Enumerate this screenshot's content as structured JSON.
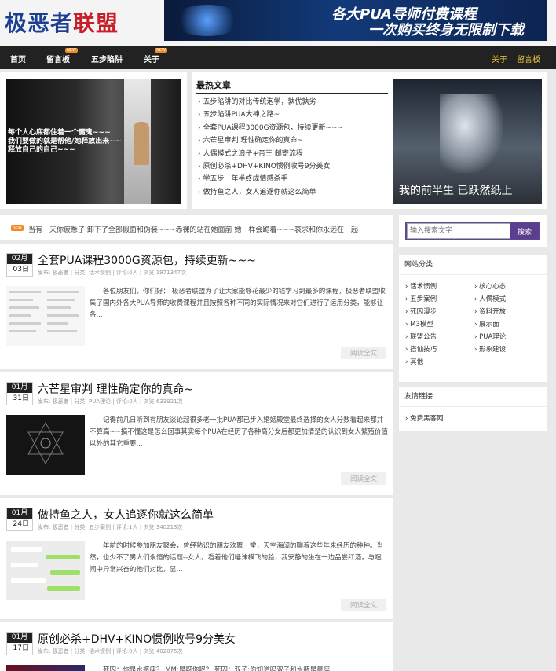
{
  "header": {
    "logo_part1": "极恶者",
    "logo_part2": "联盟",
    "banner_line1": "各大PUA导师付费课程",
    "banner_line2": "一次购买终身无限制下载"
  },
  "nav": {
    "items": [
      {
        "label": "首页"
      },
      {
        "label": "留言板",
        "badge": "NEW"
      },
      {
        "label": "五步陷阱"
      },
      {
        "label": "关于",
        "badge": "NEW"
      }
    ],
    "right": [
      "关于",
      "留言板"
    ]
  },
  "featured_left": {
    "caption": "每个人心底都住着一个魔鬼~~~\n我们要做的就是帮他/她释放出来~~\n释放自己的自己~~~"
  },
  "hot": {
    "title": "最热文章",
    "items": [
      "五步陷阱的对比传统泡学，孰优孰劣",
      "五步陷阱PUA大神之路~",
      "全套PUA课程3000G资源包，持续更新~~~",
      "六芒星审判 理性确定你的真命~",
      "人偶模式之浪子+帝王 邮寄流程",
      "原创必杀+DHV+KINO惯例收号9分美女",
      "学五步一年半终成情感杀手",
      "做持鱼之人，女人追逐你就这么简单"
    ]
  },
  "featured_right": {
    "caption": "我的前半生  已跃然纸上"
  },
  "notice": {
    "badge": "NEW",
    "text": "当有一天你疲惫了 卸下了全部假面和伪装~~~赤裸的站在她面前 她一样会跪着~~~哀求和你永远在一起"
  },
  "posts": [
    {
      "month": "02月",
      "day": "03日",
      "title": "全套PUA课程3000G资源包，持续更新~~~",
      "meta": "发布: 极恶者 | 分类: 话术惯例 | 评论:0人 | 浏览:1971347次",
      "excerpt": "各位朋友们，你们好： 极恶者联盟为了让大家能够花最少的钱学习到最多的课程，极恶者联盟收集了国内外各大PUA导师的收费课程并且按照各种不同的实际情况来对它们进行了运用分类，能够让各...",
      "more": "阅读全文"
    },
    {
      "month": "01月",
      "day": "31日",
      "title": "六芒星审判 理性确定你的真命~",
      "meta": "发布: 极恶者 | 分类: PUA理论 | 评论:0人 | 浏览:633921次",
      "excerpt": "记得前几日听到有朋友谈论起很多老一批PUA都已步入婚姻殿堂最终选择的女人分数看起来都并不算高~~搞不懂这是怎么回事其实每个PUA在经历了各种高分女后都更加清楚的认识到女人繁殖价值以外的其它重要...",
      "more": "阅读全文"
    },
    {
      "month": "01月",
      "day": "24日",
      "title": "做持鱼之人，女人追逐你就这么简单",
      "meta": "发布: 极恶者 | 分类: 五步案例 | 评论:1人 | 浏览:340213次",
      "excerpt": "年前的时候参加朋友聚会，曾经熟识的朋友欢聚一堂，天空海阔的聊着这些年来经历的种种。当然，也少不了男人们永恒的话题--女人。看着他们唾沫横飞的脸，我安静的坐在一边品尝红酒，与喧闹中异常兴奋的他们对比，显...",
      "more": "阅读全文"
    },
    {
      "month": "01月",
      "day": "17日",
      "title": "原创必杀+DHV+KINO惯例收号9分美女",
      "meta": "发布: 极恶者 | 分类: 话术惯例 | 评论:0人 | 浏览:402075次",
      "excerpt": "死囚：你是水瓶座？ MM:是呀你呢？ 死囚：双子;你知道吗双子和水瓶是星座"
    }
  ],
  "search": {
    "placeholder": "输入搜索文字",
    "button": "搜索"
  },
  "categories": {
    "title": "网站分类",
    "left": [
      "话术惯例",
      "五步案例",
      "死囚漫步",
      "M3模型",
      "联盟公告",
      "搭讪技巧",
      "其他"
    ],
    "right": [
      "核心心态",
      "人偶模式",
      "资料开放",
      "展示面",
      "PUA理论",
      "形象建设"
    ]
  },
  "friend_links": {
    "title": "友情链接",
    "items": [
      "免费黑客网"
    ]
  }
}
